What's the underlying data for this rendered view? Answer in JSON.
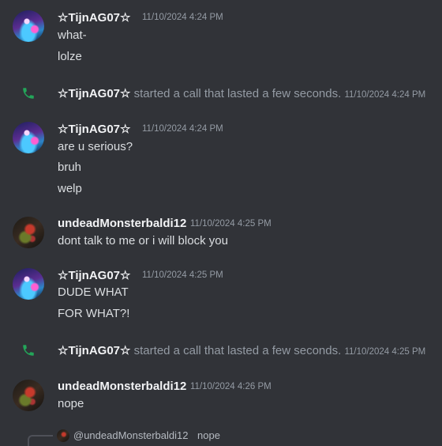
{
  "messages": [
    {
      "author": "☆TijnAG07☆",
      "timestamp": "11/10/2024 4:24 PM",
      "lines": [
        "what-",
        "lolze"
      ]
    },
    {
      "call": true,
      "author": "☆TijnAG07☆",
      "text": "started a call that lasted a few seconds.",
      "timestamp": "11/10/2024 4:24 PM"
    },
    {
      "author": "☆TijnAG07☆",
      "timestamp": "11/10/2024 4:24 PM",
      "lines": [
        "are u serious?",
        "bruh",
        "welp"
      ]
    },
    {
      "author": "undeadMonsterbaldi12",
      "timestamp": "11/10/2024 4:25 PM",
      "lines": [
        "dont talk to me or i will block you"
      ]
    },
    {
      "author": "☆TijnAG07☆",
      "timestamp": "11/10/2024 4:25 PM",
      "lines": [
        "DUDE WHAT",
        "FOR WHAT?!"
      ]
    },
    {
      "call": true,
      "author": "☆TijnAG07☆",
      "text": "started a call that lasted a few seconds.",
      "timestamp": "11/10/2024 4:25 PM"
    },
    {
      "author": "undeadMonsterbaldi12",
      "timestamp": "11/10/2024 4:26 PM",
      "lines": [
        "nope"
      ]
    }
  ],
  "reply_preview": {
    "author": "@undeadMonsterbaldi12",
    "text": "nope"
  },
  "colors": {
    "background": "#313338",
    "call_icon": "#23a559",
    "muted": "#949ba4"
  }
}
